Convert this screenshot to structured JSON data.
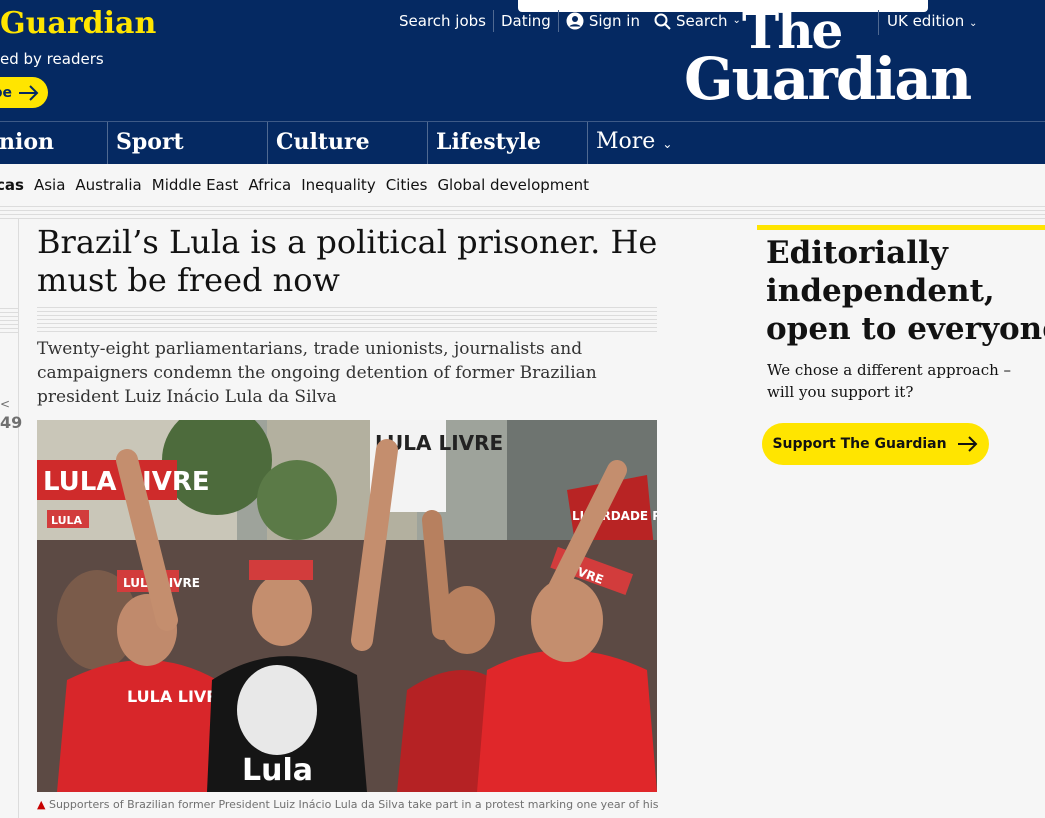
{
  "header": {
    "support_title": "Guardian",
    "support_sub": "ed by readers",
    "support_btn": "pe",
    "topnav": [
      {
        "label": "Search jobs"
      },
      {
        "label": "Dating"
      },
      {
        "label": "Sign in",
        "icon": "user-icon"
      },
      {
        "label": "Search",
        "icon": "search-icon"
      }
    ],
    "edition": "UK edition",
    "logo_line1": "The",
    "logo_line2": "Guardian"
  },
  "pillars": [
    "nion",
    "Sport",
    "Culture",
    "Lifestyle",
    "More"
  ],
  "subnav": {
    "current": "cas",
    "links": [
      "Asia",
      "Australia",
      "Middle East",
      "Africa",
      "Inequality",
      "Cities",
      "Global development"
    ]
  },
  "article": {
    "share_count": "49",
    "headline": "Brazil’s Lula is a political prisoner. He must be freed now",
    "standfirst": "Twenty-eight parliamentarians, trade unionists, journalists and campaigners condemn the ongoing detention of former Brazilian president Luiz Inácio Lula da Silva",
    "photo_texts": {
      "banner_left": "LULA LIVRE",
      "sign": "LULA LIVRE",
      "headband1": "LULA",
      "headband2": "LULA LIVRE",
      "headband3": "LIVRE",
      "shirt": "LULA LIVRE!",
      "shirt2": "Lula",
      "poster": "LIBERDADE PARA LULA"
    },
    "caption": "Supporters of Brazilian former President Luiz Inácio Lula da Silva take part in a protest marking one year of his"
  },
  "rhs": {
    "title_lines": [
      "Editorially",
      "independent,",
      "open to everyone"
    ],
    "sub": "We chose a different approach – will you support it?",
    "button": "Support The Guardian"
  },
  "colors": {
    "brand": "#052962",
    "accent": "#ffe500",
    "red": "#c70000"
  }
}
